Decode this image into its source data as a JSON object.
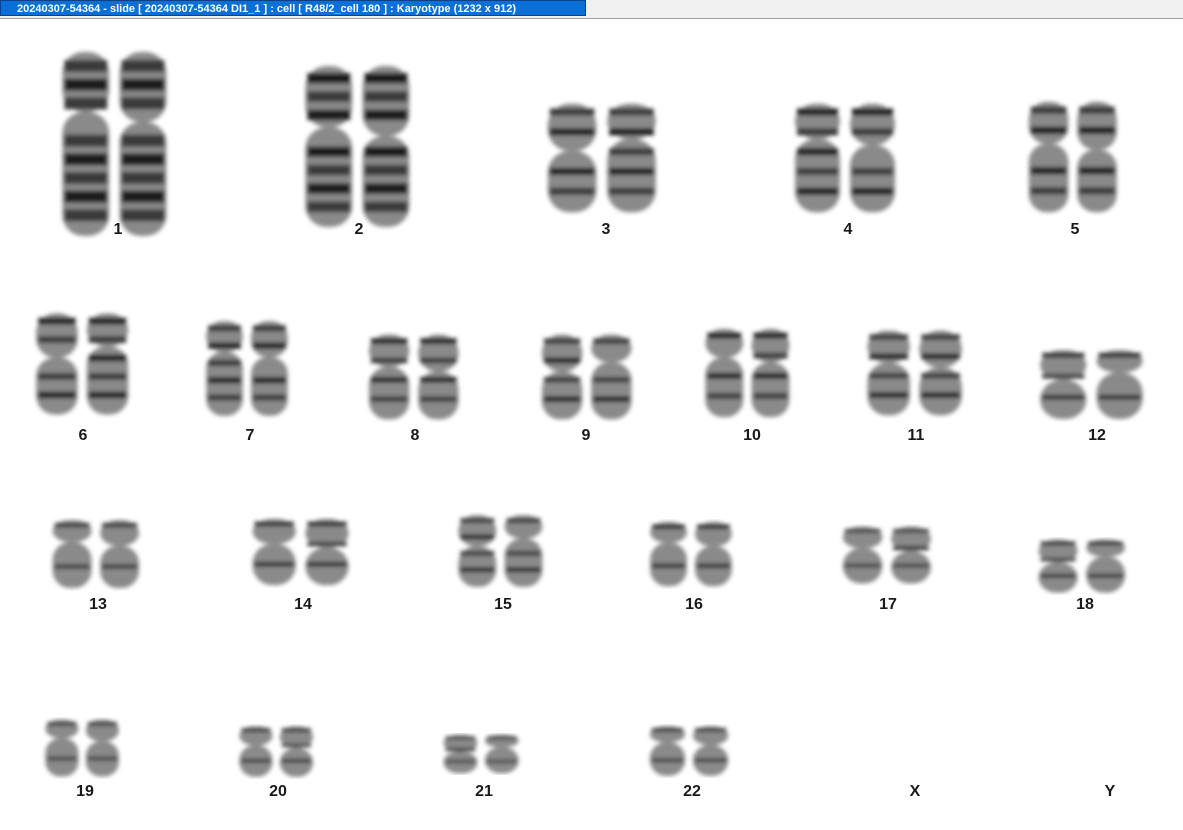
{
  "window": {
    "title": "20240307-54364 - slide [ 20240307-54364 DI1_1 ] : cell [ R48/2_cell 180 ] : Karyotype  (1232 x 912)"
  },
  "karyotype": {
    "labels": [
      "1",
      "2",
      "3",
      "4",
      "5",
      "6",
      "7",
      "8",
      "9",
      "10",
      "11",
      "12",
      "13",
      "14",
      "15",
      "16",
      "17",
      "18",
      "19",
      "20",
      "21",
      "22",
      "X",
      "Y"
    ]
  }
}
